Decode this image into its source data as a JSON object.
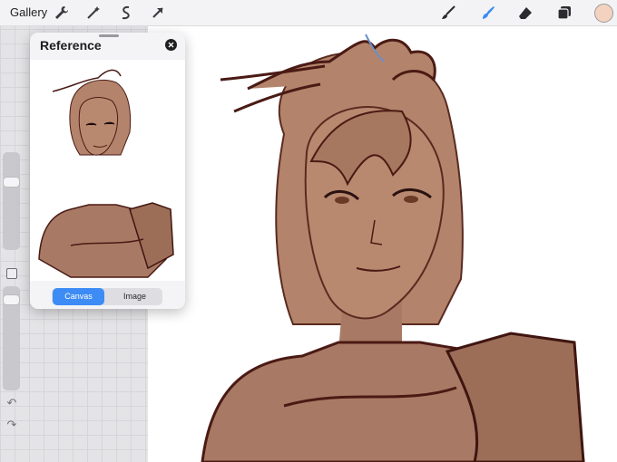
{
  "toolbar": {
    "gallery_label": "Gallery",
    "left_tools": [
      "wrench-icon",
      "magic-wand-icon",
      "selection-icon",
      "transform-arrow-icon"
    ],
    "right_tools": [
      "brush-icon",
      "smudge-icon",
      "eraser-icon",
      "layers-icon"
    ],
    "active_tool": "smudge",
    "accent_color": "#3d8cf5",
    "current_color": "#f3d3bf"
  },
  "reference": {
    "title": "Reference",
    "tabs": {
      "canvas": "Canvas",
      "image": "Image"
    },
    "active_tab": "Canvas"
  },
  "sidebar": {
    "brush_size_level": 0.82,
    "opacity_level": 1.0,
    "undo_glyph": "↶",
    "redo_glyph": "↷"
  }
}
